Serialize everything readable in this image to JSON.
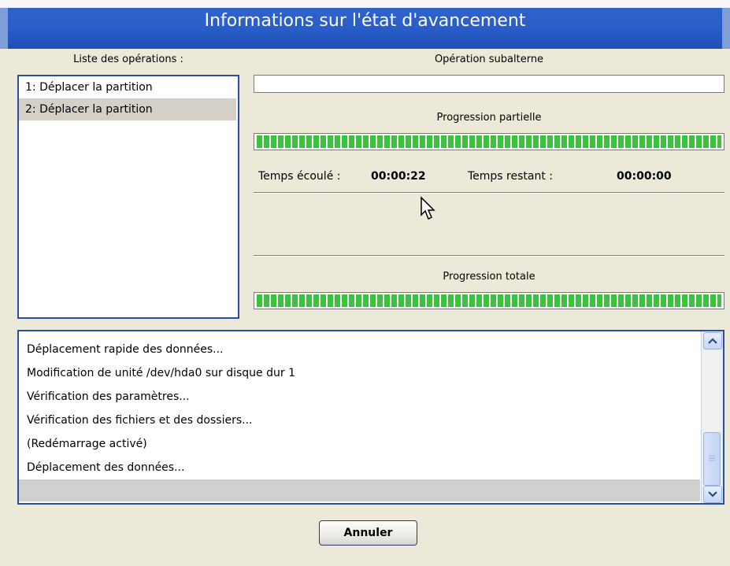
{
  "window": {
    "title": "Informations sur l'état d'avancement"
  },
  "operations": {
    "label": "Liste des opérations :",
    "items": [
      {
        "label": "1: Déplacer la partition",
        "selected": false
      },
      {
        "label": "2: Déplacer la partition",
        "selected": true
      }
    ]
  },
  "sub_operation": {
    "label": "Opération subalterne",
    "value": ""
  },
  "partial_progress": {
    "label": "Progression partielle",
    "percent": 100
  },
  "time": {
    "elapsed_label": "Temps écoulé :",
    "elapsed_value": "00:00:22",
    "remaining_label": "Temps restant :",
    "remaining_value": "00:00:00"
  },
  "total_progress": {
    "label": "Progression totale",
    "percent": 100
  },
  "log": {
    "lines": [
      "Déplacement rapide des données...",
      "Modification de unité /dev/hda0 sur disque dur  1",
      "Vérification des paramètres...",
      "Vérification des fichiers et des dossiers...",
      "(Redémarrage activé)",
      "Déplacement des données...",
      ""
    ],
    "selected_index": 6
  },
  "buttons": {
    "cancel_label": "Annuler"
  },
  "colors": {
    "title_bar": "#2a5ec9",
    "progress_fill": "#3cc23c",
    "list_border": "#2a4fa0"
  },
  "icons": {
    "scroll_up": "chevron-up-icon",
    "scroll_down": "chevron-down-icon",
    "cursor": "mouse-pointer-icon"
  }
}
